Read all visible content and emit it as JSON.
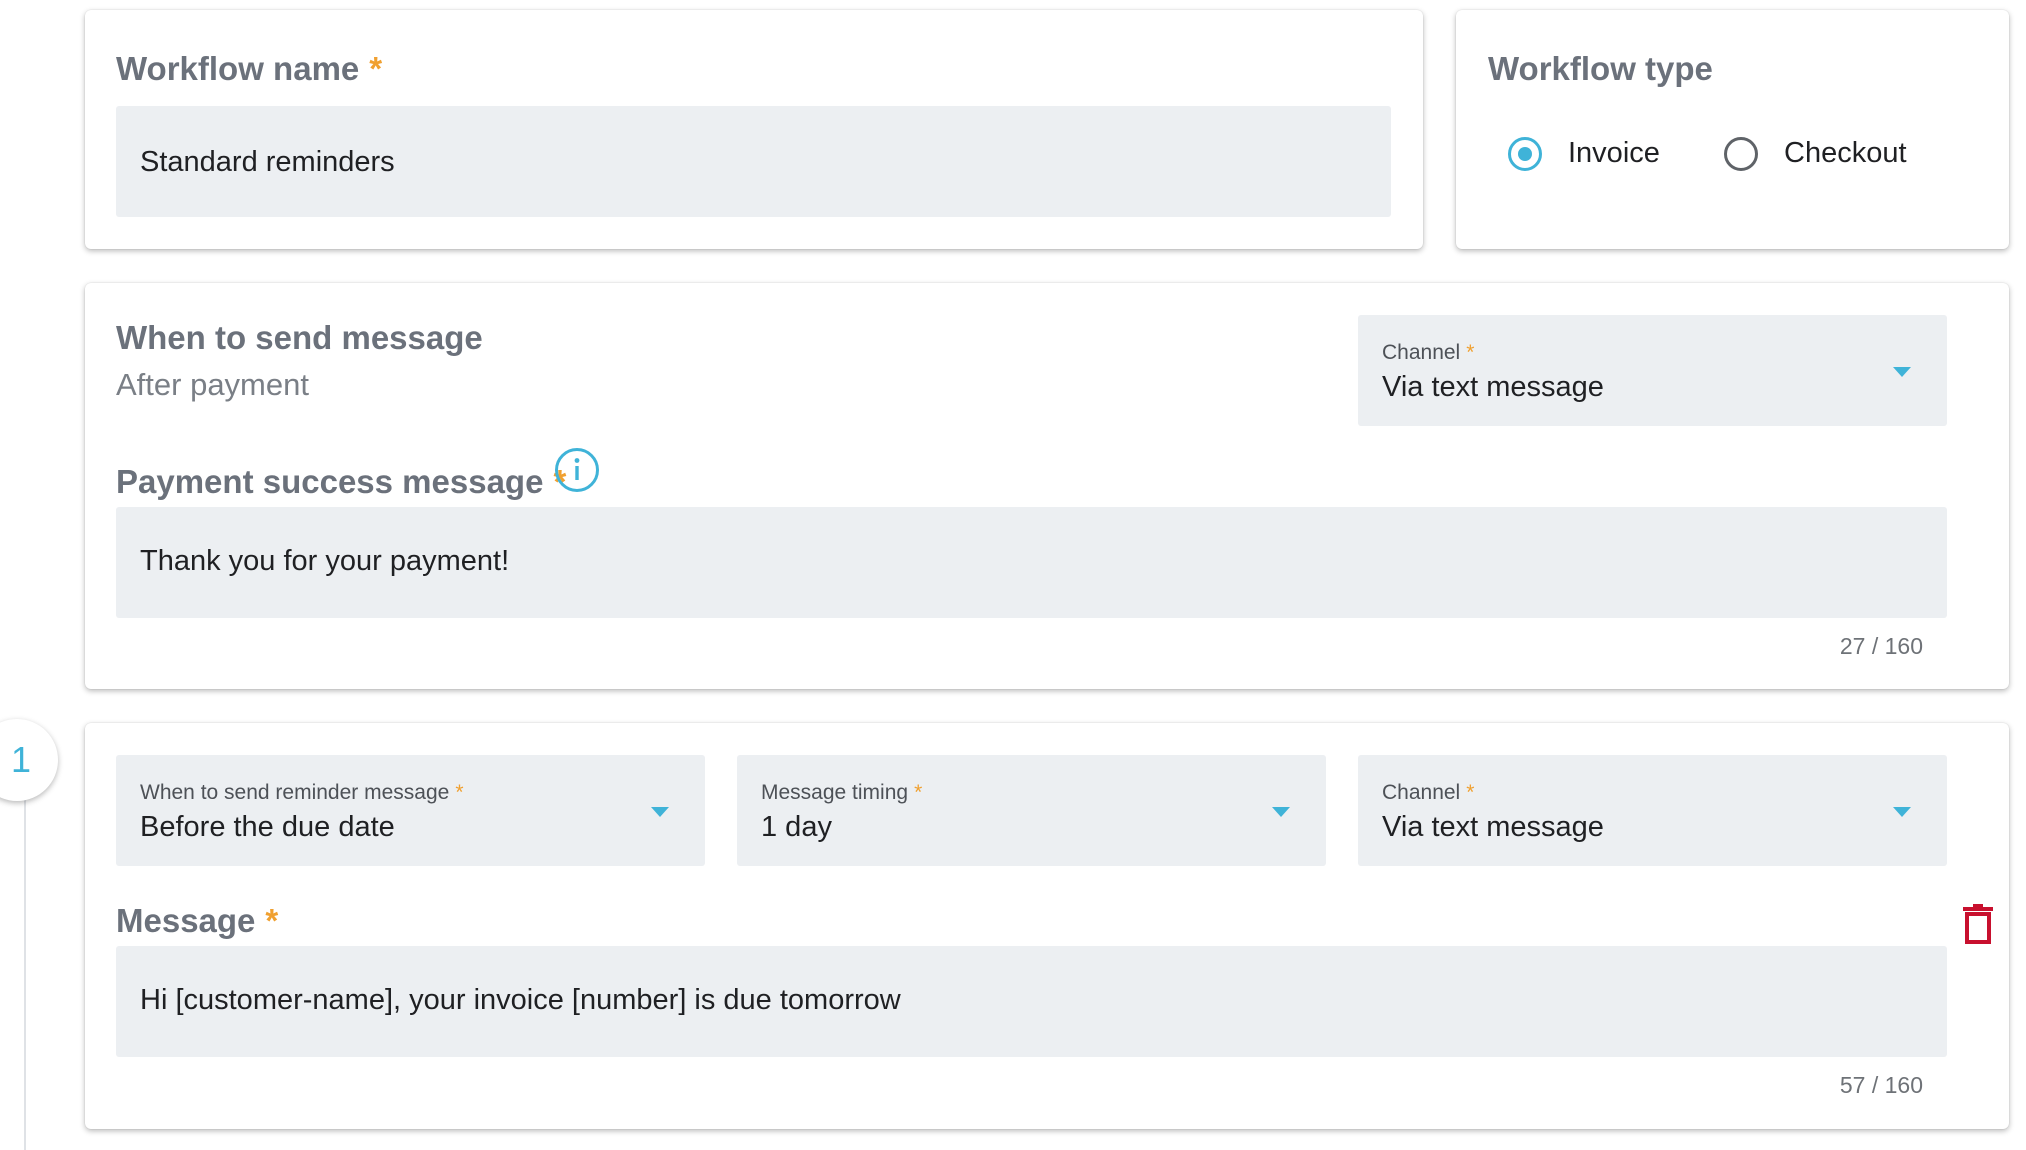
{
  "workflow_name": {
    "label": "Workflow name",
    "required_mark": "*",
    "value": "Standard reminders"
  },
  "workflow_type": {
    "label": "Workflow type",
    "options": [
      {
        "label": "Invoice",
        "selected": true
      },
      {
        "label": "Checkout",
        "selected": false
      }
    ]
  },
  "payment_section": {
    "when_label": "When to send message",
    "when_value": "After payment",
    "channel": {
      "label": "Channel",
      "required_mark": "*",
      "value": "Via text message"
    },
    "message": {
      "label": "Payment success message",
      "required_mark": "*",
      "value": "Thank you for your payment!",
      "counter": "27 / 160"
    }
  },
  "reminders": [
    {
      "step_number": "1",
      "when": {
        "label": "When to send reminder message",
        "required_mark": "*",
        "value": "Before the due date"
      },
      "timing": {
        "label": "Message timing",
        "required_mark": "*",
        "value": "1 day"
      },
      "channel": {
        "label": "Channel",
        "required_mark": "*",
        "value": "Via text message"
      },
      "message": {
        "label": "Message",
        "required_mark": "*",
        "value": "Hi [customer-name], your invoice [number] is due tomorrow",
        "counter": "57 / 160"
      }
    }
  ],
  "colors": {
    "accent": "#3fb3d8",
    "required": "#f0a030",
    "delete": "#c8102e",
    "field_bg": "#eceff2",
    "title": "#6b717b"
  },
  "icons": [
    "info-icon",
    "trash-icon",
    "chevron-down-icon"
  ]
}
